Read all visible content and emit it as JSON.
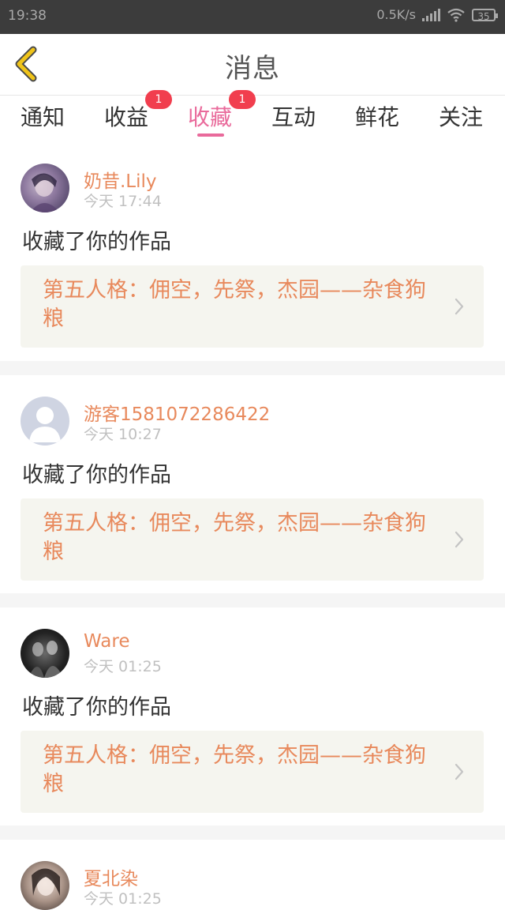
{
  "status_bar": {
    "time": "19:38",
    "speed": "0.5K/s",
    "battery": "35"
  },
  "header": {
    "title": "消息",
    "back_icon": "chevron-left-icon"
  },
  "tabs": [
    {
      "label": "通知",
      "active": false,
      "badge": ""
    },
    {
      "label": "收益",
      "active": false,
      "badge": "1"
    },
    {
      "label": "收藏",
      "active": true,
      "badge": "1"
    },
    {
      "label": "互动",
      "active": false,
      "badge": ""
    },
    {
      "label": "鲜花",
      "active": false,
      "badge": ""
    },
    {
      "label": "关注",
      "active": false,
      "badge": ""
    }
  ],
  "feed": {
    "items": [
      {
        "username": "奶昔.Lily",
        "time": "今天 17:44",
        "action": "收藏了你的作品",
        "work_title": "第五人格：佣空，先祭，杰园——杂食狗粮",
        "avatar": "avatar-photo"
      },
      {
        "username": "游客1581072286422",
        "time": "今天 10:27",
        "action": "收藏了你的作品",
        "work_title": "第五人格：佣空，先祭，杰园——杂食狗粮",
        "avatar": "avatar-default-person"
      },
      {
        "username": "Ware",
        "time": "今天 01:25",
        "action": "收藏了你的作品",
        "work_title": "第五人格：佣空，先祭，杰园——杂食狗粮",
        "avatar": "avatar-photo"
      },
      {
        "username": "夏北染",
        "time": "今天 01:25",
        "action": "",
        "work_title": "",
        "avatar": "avatar-photo"
      }
    ]
  },
  "colors": {
    "accent_pink": "#e96a9b",
    "username_orange": "#e8895c",
    "badge_red": "#f13e4e",
    "back_icon_yellow": "#f0c419",
    "work_box_bg": "#f5f5ef"
  }
}
